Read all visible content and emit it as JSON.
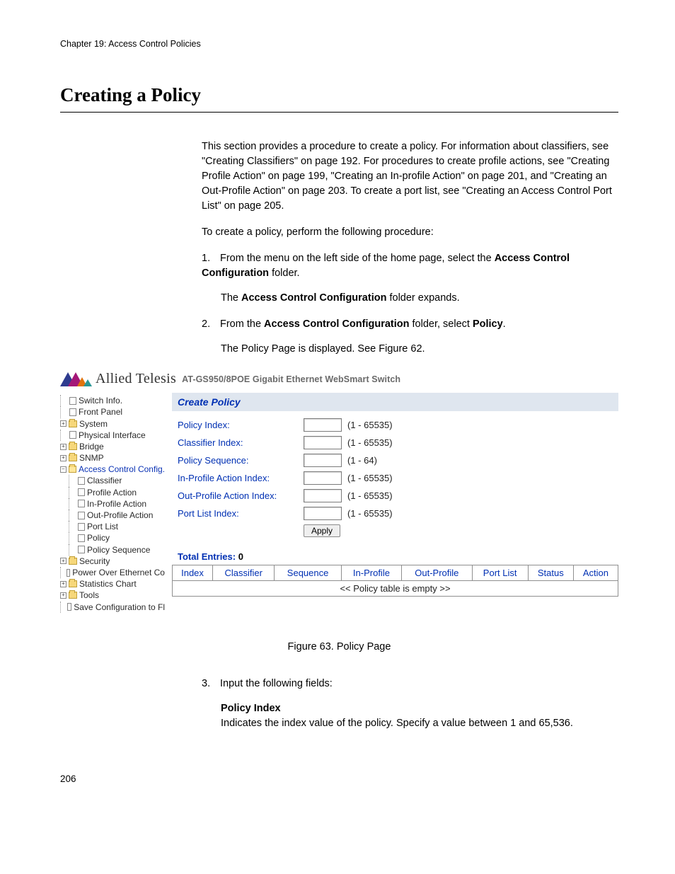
{
  "header": {
    "running": "Chapter 19: Access Control Policies"
  },
  "title": "Creating a Policy",
  "intro": "This section provides a procedure to create a policy. For information about classifiers, see \"Creating Classifiers\" on page 192. For procedures to create profile actions, see \"Creating Profile Action\" on page 199, \"Creating an In-profile Action\" on page 201, and \"Creating an Out-Profile Action\" on page 203. To create a port list, see \"Creating an Access Control Port List\" on page 205.",
  "procedure_lead": "To create a policy, perform the following procedure:",
  "steps": {
    "s1": {
      "num": "1.",
      "pre": "From the menu on the left side of the home page, select the ",
      "bold1": "Access Control Configuration",
      "post": " folder.",
      "sub_pre": "The ",
      "sub_bold": "Access Control Configuration",
      "sub_post": " folder expands."
    },
    "s2": {
      "num": "2.",
      "pre": "From the ",
      "bold1": "Access Control Configuration",
      "mid": " folder, select ",
      "bold2": "Policy",
      "post": ".",
      "sub": "The Policy Page is displayed. See Figure 62."
    },
    "s3": {
      "num": "3.",
      "text": "Input the following fields:"
    }
  },
  "brand": {
    "name": "Allied Telesis",
    "product": "AT-GS950/8POE Gigabit Ethernet WebSmart Switch"
  },
  "tree": {
    "switch_info": "Switch Info.",
    "front_panel": "Front Panel",
    "system": "System",
    "physical": "Physical Interface",
    "bridge": "Bridge",
    "snmp": "SNMP",
    "acc": "Access Control Config.",
    "classifier": "Classifier",
    "profile_action": "Profile Action",
    "in_profile": "In-Profile Action",
    "out_profile": "Out-Profile Action",
    "port_list": "Port List",
    "policy": "Policy",
    "policy_sequence": "Policy Sequence",
    "security": "Security",
    "poe": "Power Over Ethernet Co",
    "stats": "Statistics Chart",
    "tools": "Tools",
    "save": "Save Configuration to Fl"
  },
  "panel": {
    "title": "Create Policy",
    "fields": {
      "policy_index": {
        "label": "Policy Index:",
        "range": "(1 - 65535)"
      },
      "classifier_index": {
        "label": "Classifier Index:",
        "range": "(1 - 65535)"
      },
      "policy_sequence": {
        "label": "Policy Sequence:",
        "range": "(1 - 64)"
      },
      "in_profile_idx": {
        "label": "In-Profile Action Index:",
        "range": "(1 - 65535)"
      },
      "out_profile_idx": {
        "label": "Out-Profile Action Index:",
        "range": "(1 - 65535)"
      },
      "port_list_idx": {
        "label": "Port List Index:",
        "range": "(1 - 65535)"
      }
    },
    "apply": "Apply",
    "total_label": "Total Entries:  ",
    "total_value": "0",
    "columns": {
      "index": "Index",
      "classifier": "Classifier",
      "sequence": "Sequence",
      "in_profile": "In-Profile",
      "out_profile": "Out-Profile",
      "port_list": "Port List",
      "status": "Status",
      "action": "Action"
    },
    "empty": "<< Policy table is empty >>"
  },
  "figure_caption": "Figure 63. Policy Page",
  "field_def": {
    "name": "Policy Index",
    "desc": "Indicates the index value of the policy. Specify a value between 1 and 65,536."
  },
  "page_number": "206"
}
